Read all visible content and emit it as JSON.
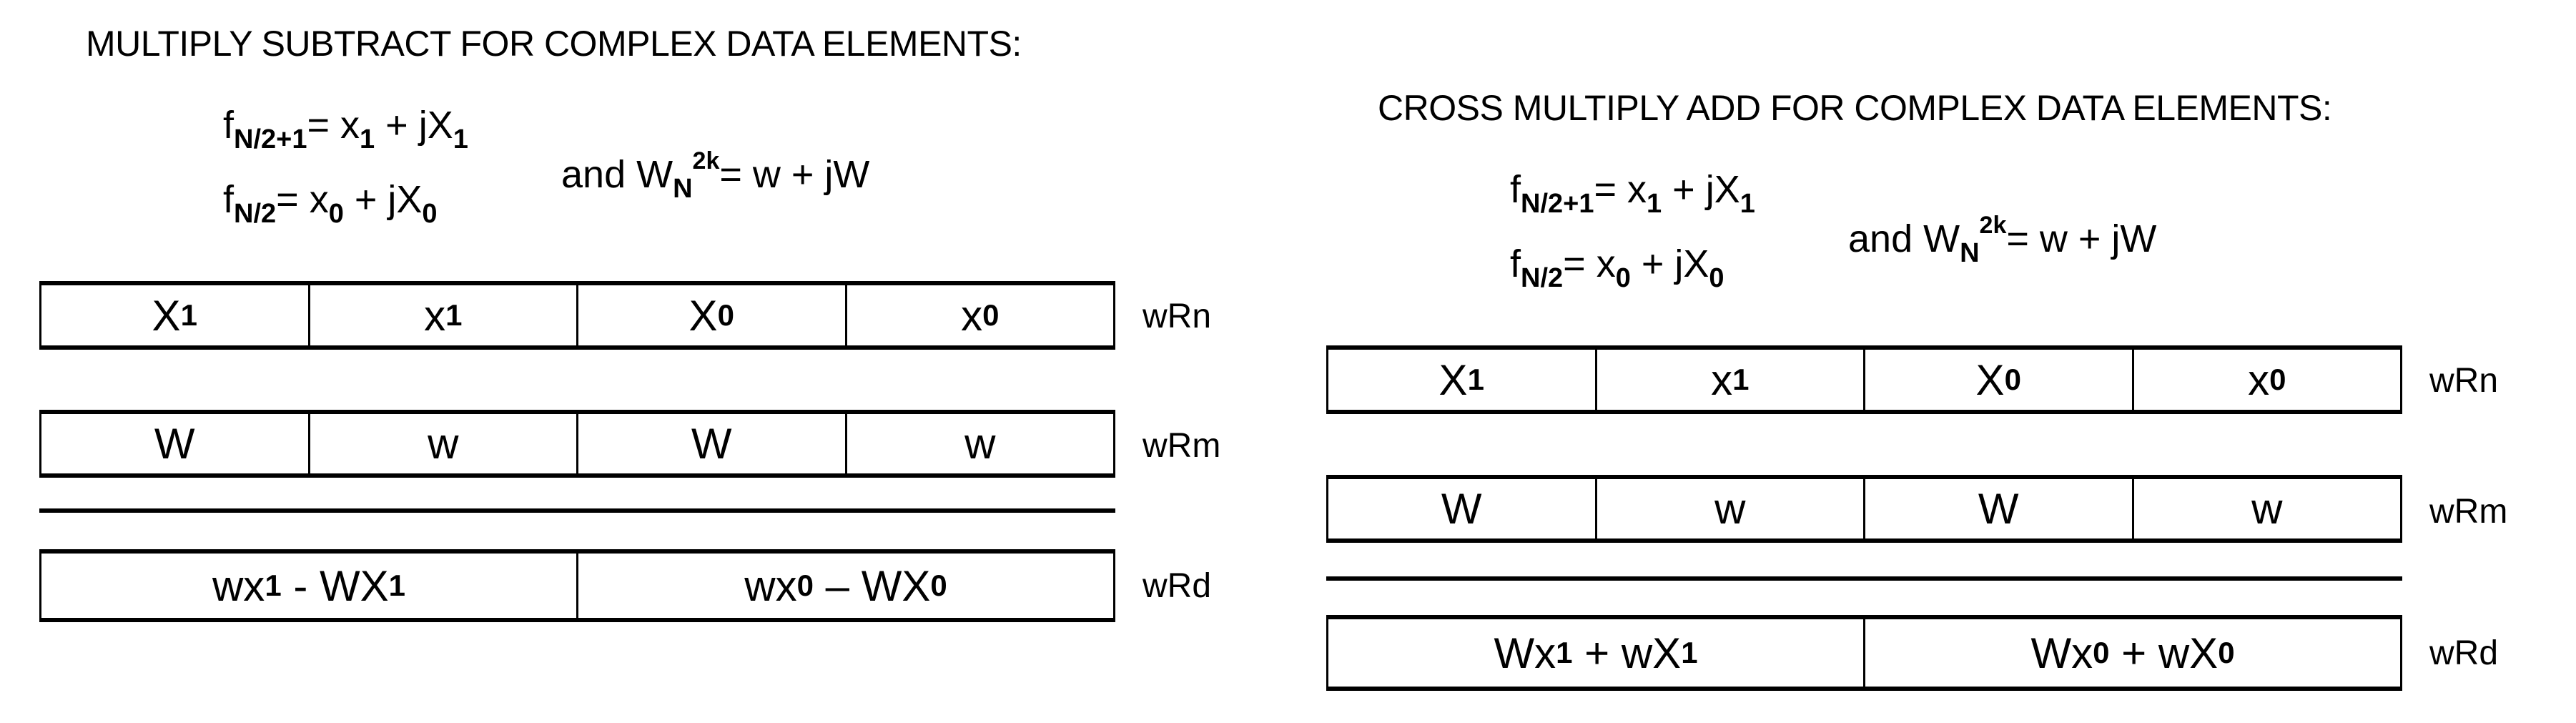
{
  "panels": [
    {
      "title": "MULTIPLY SUBTRACT FOR COMPLEX DATA ELEMENTS:",
      "formula": {
        "line1": {
          "f": "f",
          "f_sub": "N/2+1",
          "eq": "= x",
          "x_sub": "1",
          "plus": " + jX",
          "X_sub": "1"
        },
        "line2": {
          "f": "f",
          "f_sub": "N/2",
          "eq": "= x",
          "x_sub": "0",
          "plus": " + jX",
          "X_sub": "0"
        },
        "twiddle": {
          "and": "and  W",
          "W_sub": "N",
          "W_sup": "2k",
          "rest": "= w + jW"
        }
      },
      "registers": [
        {
          "label": "wRn",
          "cells": [
            {
              "base": "X",
              "sub": "1"
            },
            {
              "base": "x",
              "sub": "1"
            },
            {
              "base": "X",
              "sub": "0"
            },
            {
              "base": "x",
              "sub": "0"
            }
          ]
        },
        {
          "label": "wRm",
          "cells": [
            {
              "base": "W",
              "sub": ""
            },
            {
              "base": "w",
              "sub": ""
            },
            {
              "base": "W",
              "sub": ""
            },
            {
              "base": "w",
              "sub": ""
            }
          ]
        }
      ],
      "result": {
        "label": "wRd",
        "cells": [
          {
            "a": "wx",
            "a_sub": "1",
            "op": " - ",
            "b": "WX",
            "b_sub": "1"
          },
          {
            "a": "wx",
            "a_sub": "0",
            "op": " – ",
            "b": "WX",
            "b_sub": "0"
          }
        ]
      }
    },
    {
      "title": "CROSS MULTIPLY ADD FOR COMPLEX DATA ELEMENTS:",
      "formula": {
        "line1": {
          "f": "f",
          "f_sub": "N/2+1",
          "eq": "= x",
          "x_sub": "1",
          "plus": " + jX",
          "X_sub": "1"
        },
        "line2": {
          "f": "f",
          "f_sub": "N/2",
          "eq": "= x",
          "x_sub": "0",
          "plus": " + jX",
          "X_sub": "0"
        },
        "twiddle": {
          "and": "and  W",
          "W_sub": "N",
          "W_sup": "2k",
          "rest": "= w + jW"
        }
      },
      "registers": [
        {
          "label": "wRn",
          "cells": [
            {
              "base": "X",
              "sub": "1"
            },
            {
              "base": "x",
              "sub": "1"
            },
            {
              "base": "X",
              "sub": "0"
            },
            {
              "base": "x",
              "sub": "0"
            }
          ]
        },
        {
          "label": "wRm",
          "cells": [
            {
              "base": "W",
              "sub": ""
            },
            {
              "base": "w",
              "sub": ""
            },
            {
              "base": "W",
              "sub": ""
            },
            {
              "base": "w",
              "sub": ""
            }
          ]
        }
      ],
      "result": {
        "label": "wRd",
        "cells": [
          {
            "a": "Wx",
            "a_sub": "1",
            "op": " + ",
            "b": "wX",
            "b_sub": "1"
          },
          {
            "a": "Wx",
            "a_sub": "0",
            "op": " + ",
            "b": "wX",
            "b_sub": "0"
          }
        ]
      }
    }
  ]
}
